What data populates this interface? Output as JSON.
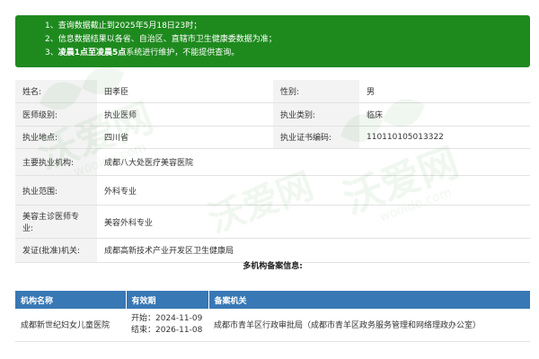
{
  "notice": {
    "line1": "1、查询数据截止到2025年5月18日23时；",
    "line2": "2、信息数据结果以各省、自治区、直辖市卫生健康委数据为准；",
    "line3_pre": "3、",
    "line3_bold": "凌晨1点至凌晨5点",
    "line3_post": "系统进行维护，不能提供查询。"
  },
  "info": {
    "name_label": "姓名:",
    "name_value": "田孝臣",
    "gender_label": "性别:",
    "gender_value": "男",
    "level_label": "医师级别:",
    "level_value": "执业医师",
    "category_label": "执业类别:",
    "category_value": "临床",
    "place_label": "执业地点:",
    "place_value": "四川省",
    "cert_label": "执业证书编码:",
    "cert_value": "110110105013322",
    "institution_label": "主要执业机构:",
    "institution_value": "成都八大处医疗美容医院",
    "scope_label": "执业范围:",
    "scope_value": "外科专业",
    "cosmetic_label": "美容主诊医师专业:",
    "cosmetic_value": "美容外科专业",
    "issuer_label": "发证(批准)机关:",
    "issuer_value": "成都高新技术产业开发区卫生健康局"
  },
  "multi_title": "多机构备案信息:",
  "records": {
    "headers": [
      "机构名称",
      "有效期",
      "备案机关"
    ],
    "rows": [
      {
        "org": "成都新世纪妇女儿童医院",
        "start": "开始：2024-11-09",
        "end": "结束：2026-11-08",
        "authority": "成都市青羊区行政审批局（成都市青羊区政务服务管理和网络理政办公室）"
      }
    ]
  },
  "watermark": {
    "text": "沃爱网",
    "sub": "wooide.com"
  },
  "colors": {
    "notice_bg": "#1e8a1e",
    "table_header_bg": "#3878b5",
    "label_bg": "#f3f3f3"
  }
}
